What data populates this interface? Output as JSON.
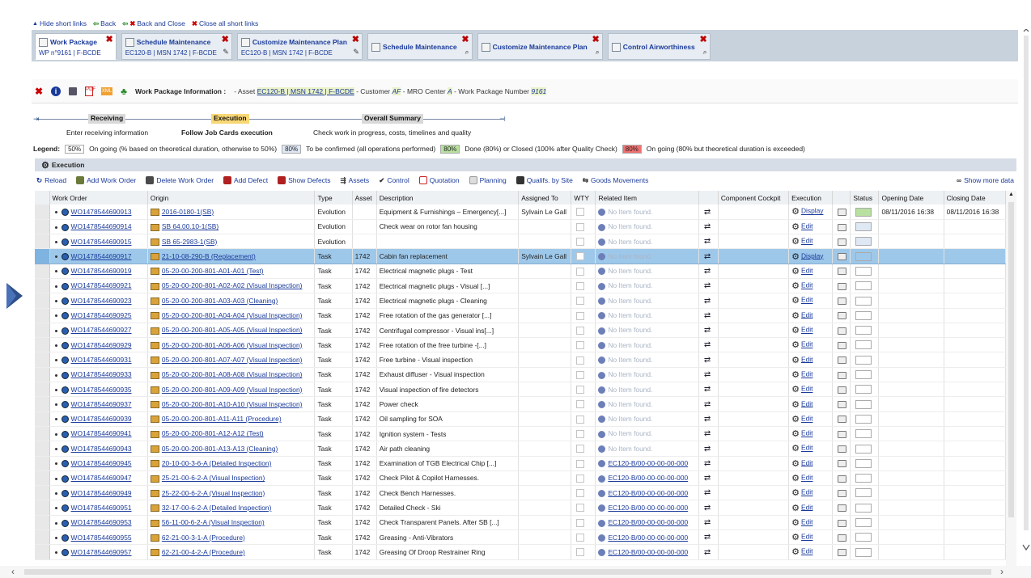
{
  "shortlinks": {
    "hide": "Hide short links",
    "back": "Back",
    "back_close": "Back and Close",
    "close_all": "Close all short links"
  },
  "tabs": [
    {
      "title": "Work Package",
      "subtitle": "WP n°9161 | F-BCDE",
      "active": true,
      "tool": "none"
    },
    {
      "title": "Schedule Maintenance",
      "subtitle": "EC120-B | MSN 1742 | F-BCDE",
      "active": false,
      "tool": "pencil"
    },
    {
      "title": "Customize Maintenance Plan",
      "subtitle": "EC120-B | MSN 1742 | F-BCDE",
      "active": false,
      "tool": "pencil"
    },
    {
      "title": "Schedule Maintenance",
      "subtitle": "",
      "active": false,
      "tool": "search"
    },
    {
      "title": "Customize Maintenance Plan",
      "subtitle": "",
      "active": false,
      "tool": "search"
    },
    {
      "title": "Control Airworthiness",
      "subtitle": "",
      "active": false,
      "tool": "search"
    }
  ],
  "info": {
    "title": "Work Package Information : ",
    "asset_prefix": "- Asset",
    "asset_link": "EC120-B | MSN 1742 | F-BCDE",
    "customer_prefix": "- Customer",
    "customer": "AF",
    "mro_prefix": "- MRO Center",
    "mro": "A",
    "wp_prefix": "- Work Package Number",
    "wp_number": "9161"
  },
  "steps": [
    {
      "label": "Receiving",
      "desc": "Enter receiving information",
      "active": false
    },
    {
      "label": "Execution",
      "desc": "Follow Job Cards execution",
      "active": true
    },
    {
      "label": "Overall Summary",
      "desc": "Check work in progress, costs, timelines and quality",
      "active": false
    }
  ],
  "legend": {
    "label": "Legend:",
    "items": [
      {
        "box": "50%",
        "color": "#ffffff",
        "text": "On going (% based on theoretical duration, otherwise to 50%)"
      },
      {
        "box": "80%",
        "color": "#dfe8f5",
        "text": "To be confirmed (all operations performed)"
      },
      {
        "box": "80%",
        "color": "#b8e0a0",
        "text": "Done (80%) or Closed (100% after Quality Check)"
      },
      {
        "box": "80%",
        "color": "#f07070",
        "text": "On going (80% but theoretical duration is exceeded)"
      }
    ]
  },
  "section_title": "Execution",
  "toolbar": {
    "reload": "Reload",
    "add_work_order": "Add Work Order",
    "delete_work_order": "Delete Work Order",
    "add_defect": "Add Defect",
    "show_defects": "Show Defects",
    "assets": "Assets",
    "control": "Control",
    "quotation": "Quotation",
    "planning": "Planning",
    "qualifs": "Qualifs. by Site",
    "goods": "Goods Movements",
    "show_more": "Show more data"
  },
  "columns": [
    "Work Order",
    "Origin",
    "Type",
    "Asset",
    "Description",
    "Assigned To",
    "WTY",
    "Related Item",
    "",
    "Component Cockpit",
    "Execution",
    "",
    "Status",
    "Opening Date",
    "Closing Date"
  ],
  "rows": [
    {
      "wo": "WO1478544690913",
      "origin": "2016-0180-1(SB)",
      "type": "Evolution",
      "asset": "",
      "desc": "Equipment & Furnishings – Emergency[...]",
      "assigned": "Sylvain Le Gall",
      "related": "No Item found.",
      "related_link": false,
      "exec": "Display",
      "status": "#b8e0a0",
      "open": "08/11/2016 16:38",
      "close": "08/11/2016 16:38",
      "selected": false
    },
    {
      "wo": "WO1478544690914",
      "origin": "SB 64.00.10-1(SB)",
      "type": "Evolution",
      "asset": "",
      "desc": "Check wear on rotor fan housing",
      "assigned": "",
      "related": "No Item found.",
      "related_link": false,
      "exec": "Edit",
      "status": "#dfe8f5",
      "open": "",
      "close": "",
      "selected": false
    },
    {
      "wo": "WO1478544690915",
      "origin": "SB 65-2983-1(SB)",
      "type": "Evolution",
      "asset": "",
      "desc": "",
      "assigned": "",
      "related": "No Item found.",
      "related_link": false,
      "exec": "Edit",
      "status": "#dfe8f5",
      "open": "",
      "close": "",
      "selected": false
    },
    {
      "wo": "WO1478544690917",
      "origin": "21-10-08-290-B (Replacement)",
      "type": "Task",
      "asset": "1742",
      "desc": "Cabin fan replacement",
      "assigned": "Sylvain Le Gall",
      "related": "No Item found.",
      "related_link": false,
      "exec": "Display",
      "status": "#9ec8ea",
      "open": "",
      "close": "",
      "selected": true
    },
    {
      "wo": "WO1478544690919",
      "origin": "05-20-00-200-801-A01-A01 (Test)",
      "type": "Task",
      "asset": "1742",
      "desc": "Electrical magnetic plugs - Test",
      "assigned": "",
      "related": "No Item found.",
      "related_link": false,
      "exec": "Edit",
      "status": "#ffffff",
      "open": "",
      "close": "",
      "selected": false
    },
    {
      "wo": "WO1478544690921",
      "origin": "05-20-00-200-801-A02-A02 (Visual Inspection)",
      "type": "Task",
      "asset": "1742",
      "desc": "Electrical magnetic plugs - Visual [...]",
      "assigned": "",
      "related": "No Item found.",
      "related_link": false,
      "exec": "Edit",
      "status": "#ffffff",
      "open": "",
      "close": "",
      "selected": false
    },
    {
      "wo": "WO1478544690923",
      "origin": "05-20-00-200-801-A03-A03 (Cleaning)",
      "type": "Task",
      "asset": "1742",
      "desc": "Electrical magnetic plugs - Cleaning",
      "assigned": "",
      "related": "No Item found.",
      "related_link": false,
      "exec": "Edit",
      "status": "#ffffff",
      "open": "",
      "close": "",
      "selected": false
    },
    {
      "wo": "WO1478544690925",
      "origin": "05-20-00-200-801-A04-A04 (Visual Inspection)",
      "type": "Task",
      "asset": "1742",
      "desc": "Free rotation of the gas generator [...]",
      "assigned": "",
      "related": "No Item found.",
      "related_link": false,
      "exec": "Edit",
      "status": "#ffffff",
      "open": "",
      "close": "",
      "selected": false
    },
    {
      "wo": "WO1478544690927",
      "origin": "05-20-00-200-801-A05-A05 (Visual Inspection)",
      "type": "Task",
      "asset": "1742",
      "desc": "Centrifugal compressor - Visual ins[...]",
      "assigned": "",
      "related": "No Item found.",
      "related_link": false,
      "exec": "Edit",
      "status": "#ffffff",
      "open": "",
      "close": "",
      "selected": false
    },
    {
      "wo": "WO1478544690929",
      "origin": "05-20-00-200-801-A06-A06 (Visual Inspection)",
      "type": "Task",
      "asset": "1742",
      "desc": "Free rotation of the free turbine -[...]",
      "assigned": "",
      "related": "No Item found.",
      "related_link": false,
      "exec": "Edit",
      "status": "#ffffff",
      "open": "",
      "close": "",
      "selected": false
    },
    {
      "wo": "WO1478544690931",
      "origin": "05-20-00-200-801-A07-A07 (Visual Inspection)",
      "type": "Task",
      "asset": "1742",
      "desc": "Free turbine - Visual inspection",
      "assigned": "",
      "related": "No Item found.",
      "related_link": false,
      "exec": "Edit",
      "status": "#ffffff",
      "open": "",
      "close": "",
      "selected": false
    },
    {
      "wo": "WO1478544690933",
      "origin": "05-20-00-200-801-A08-A08 (Visual Inspection)",
      "type": "Task",
      "asset": "1742",
      "desc": "Exhaust diffuser - Visual inspection",
      "assigned": "",
      "related": "No Item found.",
      "related_link": false,
      "exec": "Edit",
      "status": "#ffffff",
      "open": "",
      "close": "",
      "selected": false
    },
    {
      "wo": "WO1478544690935",
      "origin": "05-20-00-200-801-A09-A09 (Visual Inspection)",
      "type": "Task",
      "asset": "1742",
      "desc": "Visual inspection of fire detectors",
      "assigned": "",
      "related": "No Item found.",
      "related_link": false,
      "exec": "Edit",
      "status": "#ffffff",
      "open": "",
      "close": "",
      "selected": false
    },
    {
      "wo": "WO1478544690937",
      "origin": "05-20-00-200-801-A10-A10 (Visual Inspection)",
      "type": "Task",
      "asset": "1742",
      "desc": "Power check",
      "assigned": "",
      "related": "No Item found.",
      "related_link": false,
      "exec": "Edit",
      "status": "#ffffff",
      "open": "",
      "close": "",
      "selected": false
    },
    {
      "wo": "WO1478544690939",
      "origin": "05-20-00-200-801-A11-A11 (Procedure)",
      "type": "Task",
      "asset": "1742",
      "desc": "Oil sampling for SOA",
      "assigned": "",
      "related": "No Item found.",
      "related_link": false,
      "exec": "Edit",
      "status": "#ffffff",
      "open": "",
      "close": "",
      "selected": false
    },
    {
      "wo": "WO1478544690941",
      "origin": "05-20-00-200-801-A12-A12 (Test)",
      "type": "Task",
      "asset": "1742",
      "desc": "Ignition system - Tests",
      "assigned": "",
      "related": "No Item found.",
      "related_link": false,
      "exec": "Edit",
      "status": "#ffffff",
      "open": "",
      "close": "",
      "selected": false
    },
    {
      "wo": "WO1478544690943",
      "origin": "05-20-00-200-801-A13-A13 (Cleaning)",
      "type": "Task",
      "asset": "1742",
      "desc": "Air path cleaning",
      "assigned": "",
      "related": "No Item found.",
      "related_link": false,
      "exec": "Edit",
      "status": "#ffffff",
      "open": "",
      "close": "",
      "selected": false
    },
    {
      "wo": "WO1478544690945",
      "origin": "20-10-00-3-6-A (Detailed Inspection)",
      "type": "Task",
      "asset": "1742",
      "desc": "Examination of TGB Electrical Chip [...]",
      "assigned": "",
      "related": "EC120-B/00-00-00-00-000",
      "related_link": true,
      "exec": "Edit",
      "status": "#ffffff",
      "open": "",
      "close": "",
      "selected": false
    },
    {
      "wo": "WO1478544690947",
      "origin": "25-21-00-6-2-A (Visual Inspection)",
      "type": "Task",
      "asset": "1742",
      "desc": "Check Pilot & Copilot Harnesses.",
      "assigned": "",
      "related": "EC120-B/00-00-00-00-000",
      "related_link": true,
      "exec": "Edit",
      "status": "#ffffff",
      "open": "",
      "close": "",
      "selected": false
    },
    {
      "wo": "WO1478544690949",
      "origin": "25-22-00-6-2-A (Visual Inspection)",
      "type": "Task",
      "asset": "1742",
      "desc": "Check Bench Harnesses.",
      "assigned": "",
      "related": "EC120-B/00-00-00-00-000",
      "related_link": true,
      "exec": "Edit",
      "status": "#ffffff",
      "open": "",
      "close": "",
      "selected": false
    },
    {
      "wo": "WO1478544690951",
      "origin": "32-17-00-6-2-A (Detailed Inspection)",
      "type": "Task",
      "asset": "1742",
      "desc": "Detailed Check - Ski",
      "assigned": "",
      "related": "EC120-B/00-00-00-00-000",
      "related_link": true,
      "exec": "Edit",
      "status": "#ffffff",
      "open": "",
      "close": "",
      "selected": false
    },
    {
      "wo": "WO1478544690953",
      "origin": "56-11-00-6-2-A (Visual Inspection)",
      "type": "Task",
      "asset": "1742",
      "desc": "Check Transparent Panels. After SB [...]",
      "assigned": "",
      "related": "EC120-B/00-00-00-00-000",
      "related_link": true,
      "exec": "Edit",
      "status": "#ffffff",
      "open": "",
      "close": "",
      "selected": false
    },
    {
      "wo": "WO1478544690955",
      "origin": "62-21-00-3-1-A (Procedure)",
      "type": "Task",
      "asset": "1742",
      "desc": "Greasing - Anti-Vibrators",
      "assigned": "",
      "related": "EC120-B/00-00-00-00-000",
      "related_link": true,
      "exec": "Edit",
      "status": "#ffffff",
      "open": "",
      "close": "",
      "selected": false
    },
    {
      "wo": "WO1478544690957",
      "origin": "62-21-00-4-2-A (Procedure)",
      "type": "Task",
      "asset": "1742",
      "desc": "Greasing Of Droop Restrainer Ring",
      "assigned": "",
      "related": "EC120-B/00-00-00-00-000",
      "related_link": true,
      "exec": "Edit",
      "status": "#ffffff",
      "open": "",
      "close": "",
      "selected": false
    }
  ]
}
